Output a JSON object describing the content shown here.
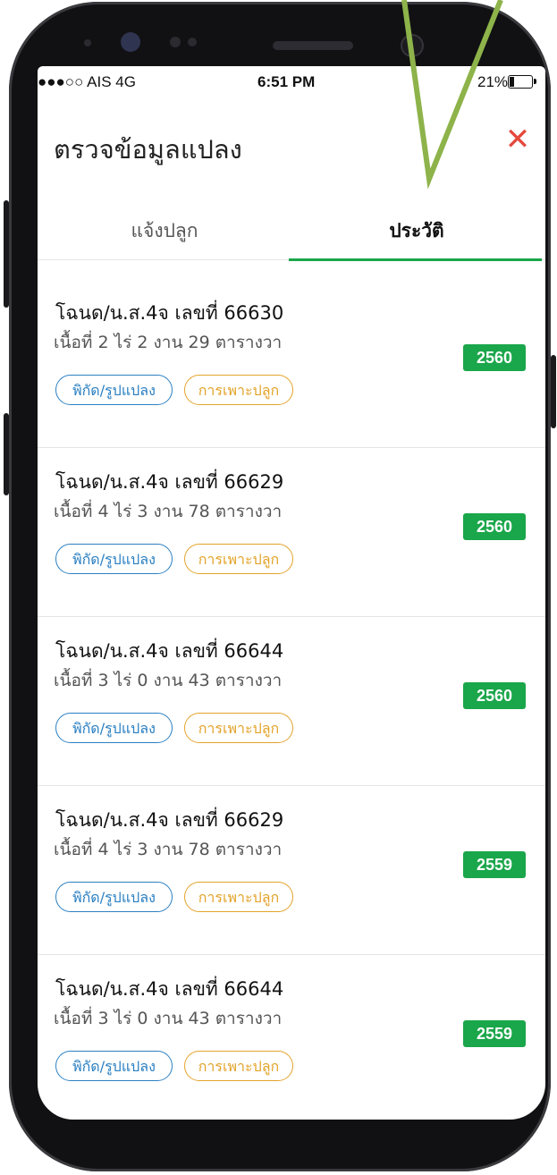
{
  "status_bar": {
    "carrier": "●●●○○ AIS  4G",
    "time": "6:51 PM",
    "battery": "21%"
  },
  "header": {
    "title": "ตรวจข้อมูลแปลง",
    "close_icon": "close-icon"
  },
  "tabs": [
    {
      "label": "แจ้งปลูก",
      "active": false
    },
    {
      "label": "ประวัติ",
      "active": true
    }
  ],
  "records": [
    {
      "title": "โฉนด/น.ส.4จ เลขที่ 66630",
      "area": "เนื้อที่ 2 ไร่ 2 งาน 29 ตารางวา",
      "year": "2560",
      "btn_location": "พิกัด/รูปแปลง",
      "btn_planting": "การเพาะปลูก"
    },
    {
      "title": "โฉนด/น.ส.4จ เลขที่ 66629",
      "area": "เนื้อที่ 4 ไร่ 3 งาน 78 ตารางวา",
      "year": "2560",
      "btn_location": "พิกัด/รูปแปลง",
      "btn_planting": "การเพาะปลูก"
    },
    {
      "title": "โฉนด/น.ส.4จ เลขที่ 66644",
      "area": "เนื้อที่ 3 ไร่ 0 งาน 43 ตารางวา",
      "year": "2560",
      "btn_location": "พิกัด/รูปแปลง",
      "btn_planting": "การเพาะปลูก"
    },
    {
      "title": "โฉนด/น.ส.4จ เลขที่ 66629",
      "area": "เนื้อที่ 4 ไร่ 3 งาน 78 ตารางวา",
      "year": "2559",
      "btn_location": "พิกัด/รูปแปลง",
      "btn_planting": "การเพาะปลูก"
    },
    {
      "title": "โฉนด/น.ส.4จ เลขที่ 66644",
      "area": "เนื้อที่ 3 ไร่ 0 งาน 43 ตารางวา",
      "year": "2559",
      "btn_location": "พิกัด/รูปแปลง",
      "btn_planting": "การเพาะปลูก"
    }
  ],
  "colors": {
    "accent_green": "#1aa64a",
    "close_red": "#e5483c",
    "location_blue": "#2b80c2",
    "planting_orange": "#e3a32a",
    "annotation_arrow": "#8db34a"
  }
}
